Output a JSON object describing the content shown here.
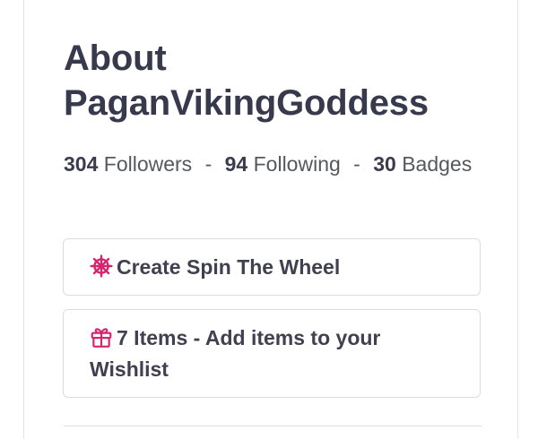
{
  "about": {
    "title_line1": "About",
    "title_line2": "PaganVikingGoddess"
  },
  "stats": {
    "followers_count": "304",
    "followers_label": "Followers",
    "following_count": "94",
    "following_label": "Following",
    "badges_count": "30",
    "badges_label": "Badges",
    "separator": "-"
  },
  "actions": {
    "spin_label": "Create Spin The Wheel",
    "spin_icon": "wheel-icon",
    "wishlist_label": "7 Items - Add items to your Wishlist",
    "wishlist_icon": "gift-icon"
  },
  "colors": {
    "accent": "#d6246e",
    "title": "#373a4d",
    "text": "#55585f",
    "border": "#dcdcdf"
  }
}
